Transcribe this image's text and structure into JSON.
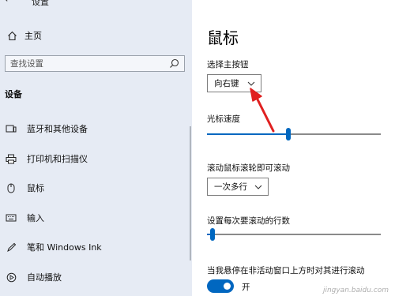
{
  "window": {
    "title": "设置"
  },
  "sidebar": {
    "home_label": "主页",
    "search_placeholder": "查找设置",
    "section_label": "设备",
    "items": [
      {
        "label": "蓝牙和其他设备",
        "icon": "bluetooth-devices-icon"
      },
      {
        "label": "打印机和扫描仪",
        "icon": "printer-icon"
      },
      {
        "label": "鼠标",
        "icon": "mouse-icon"
      },
      {
        "label": "输入",
        "icon": "keyboard-icon"
      },
      {
        "label": "笔和 Windows Ink",
        "icon": "pen-icon"
      },
      {
        "label": "自动播放",
        "icon": "autoplay-icon"
      }
    ]
  },
  "main": {
    "title": "鼠标",
    "primary_button": {
      "label": "选择主按钮",
      "value": "向右键"
    },
    "cursor_speed": {
      "label": "光标速度",
      "level": 0.47
    },
    "scroll": {
      "label": "滚动鼠标滚轮即可滚动",
      "value": "一次多行"
    },
    "lines_to_scroll": {
      "label": "设置每次要滚动的行数",
      "level": 0.03
    },
    "inactive_scroll": {
      "label": "当我悬停在非活动窗口上方时对其进行滚动",
      "toggle_label": "开",
      "state": "on"
    }
  },
  "annotation": {
    "color": "#e02020"
  },
  "accent_color": "#0067c0",
  "watermark": "jingyan.baidu.com"
}
